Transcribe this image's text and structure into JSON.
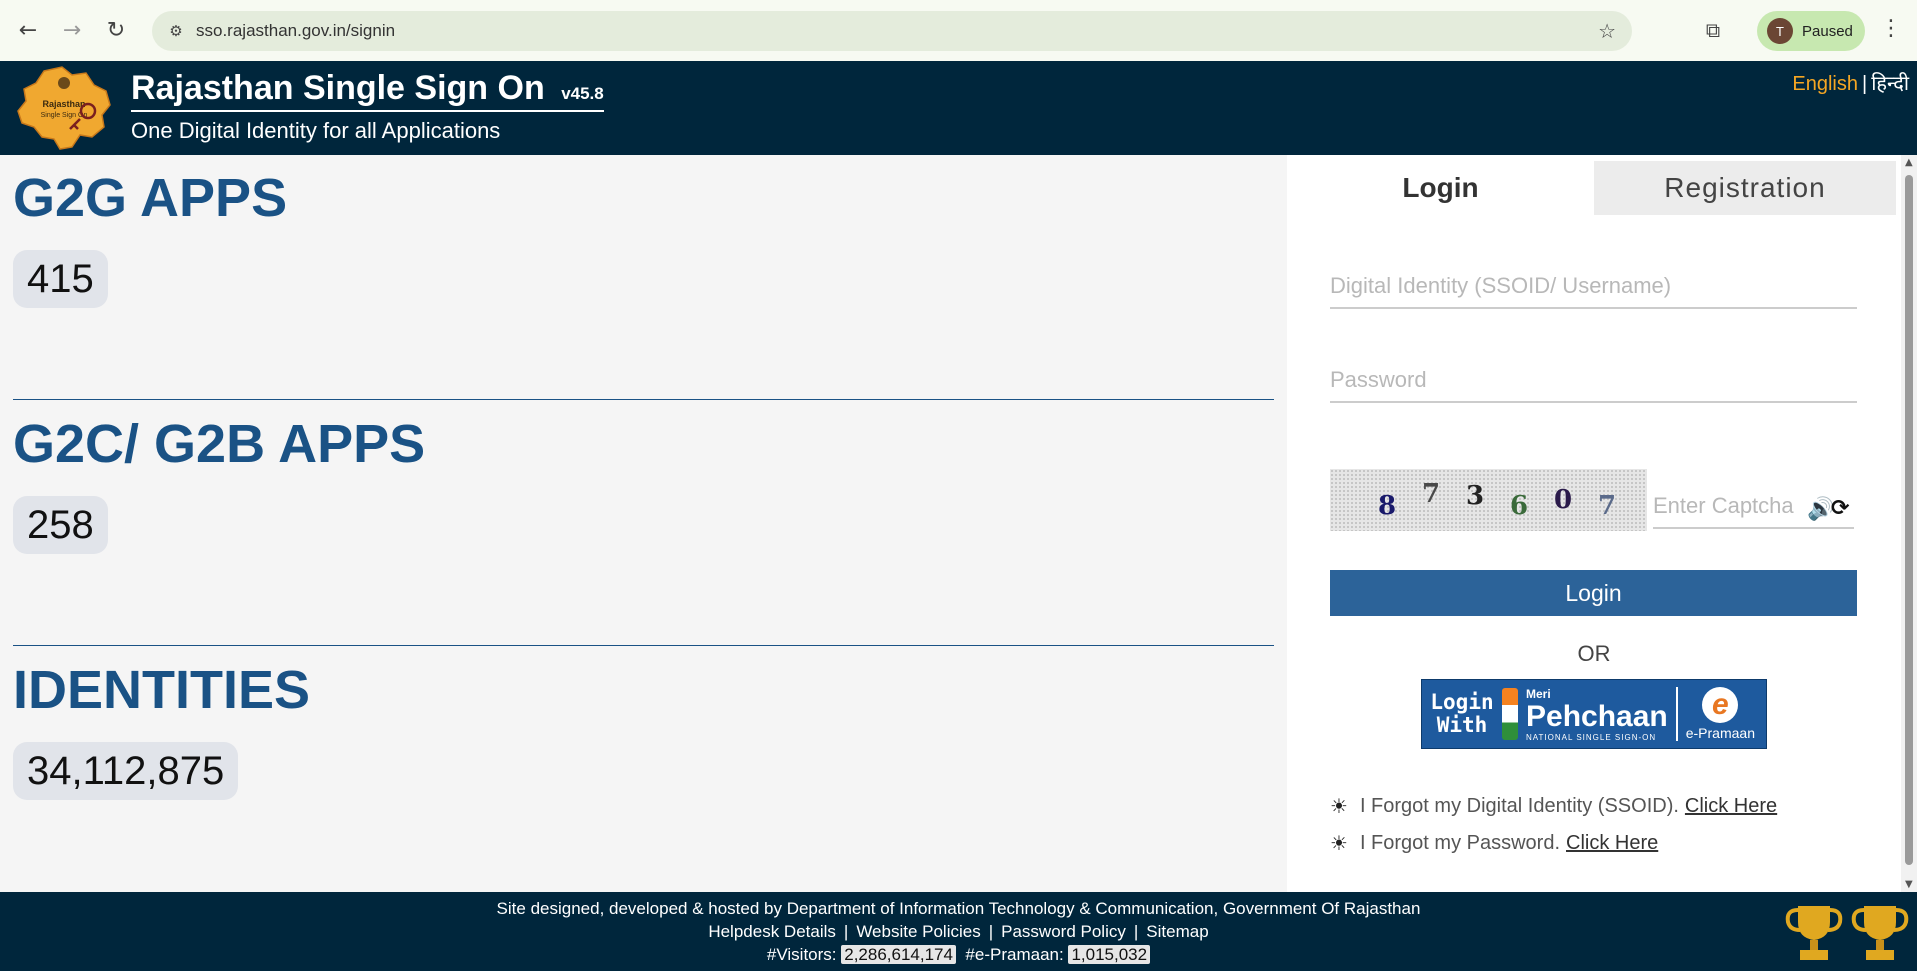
{
  "browser": {
    "url": "sso.rajasthan.gov.in/signin",
    "profile_initial": "T",
    "profile_status": "Paused"
  },
  "header": {
    "title": "Rajasthan Single Sign On",
    "version": "v45.8",
    "tagline": "One Digital Identity for all Applications",
    "logo_text_line1": "Rajasthan",
    "logo_text_line2": "Single Sign On",
    "lang_english": "English",
    "lang_separator": "|",
    "lang_hindi": "हिन्दी"
  },
  "stats": [
    {
      "title": "G2G APPS",
      "value": "415"
    },
    {
      "title": "G2C/ G2B APPS",
      "value": "258"
    },
    {
      "title": "IDENTITIES",
      "value": "34,112,875"
    }
  ],
  "login": {
    "tab_login": "Login",
    "tab_registration": "Registration",
    "username_placeholder": "Digital Identity (SSOID/ Username)",
    "password_placeholder": "Password",
    "captcha_digits": [
      "8",
      "7",
      "3",
      "6",
      "0",
      "7"
    ],
    "captcha_placeholder": "Enter Captcha",
    "login_button": "Login",
    "or_text": "OR",
    "pehchaan_login_line1": "Login",
    "pehchaan_login_line2": "With",
    "pehchaan_meri": "Meri",
    "pehchaan_name": "Pehchaan",
    "pehchaan_sub": "NATIONAL SINGLE SIGN-ON",
    "pehchaan_epramaan": "e-Pramaan",
    "forgot_ssoid": "I Forgot my Digital Identity (SSOID).",
    "forgot_password": "I Forgot my Password.",
    "click_here": "Click Here"
  },
  "footer": {
    "credit": "Site designed, developed & hosted by Department of Information Technology & Communication, Government Of Rajasthan",
    "links": [
      "Helpdesk Details",
      "Website Policies",
      "Password Policy",
      "Sitemap"
    ],
    "visitors_label": "#Visitors:",
    "visitors_count": "2,286,614,174",
    "epramaan_label": "#e-Pramaan:",
    "epramaan_count": "1,015,032"
  },
  "colors": {
    "header_bg": "#00263c",
    "accent_blue": "#1a5285",
    "login_button": "#2c6399",
    "lang_active": "#f5a623"
  }
}
